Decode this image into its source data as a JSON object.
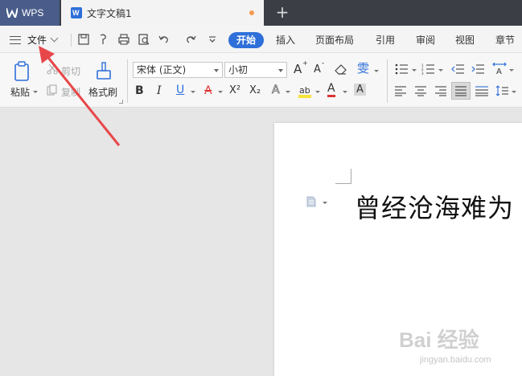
{
  "app": {
    "name": "WPS"
  },
  "tabs": {
    "doc_title": "文字文稿1",
    "add_glyph": "+"
  },
  "menu": {
    "file_label": "文件",
    "ribbon_tabs": [
      "开始",
      "插入",
      "页面布局",
      "引用",
      "审阅",
      "视图",
      "章节"
    ],
    "active_tab": "开始"
  },
  "ribbon": {
    "paste_label": "粘贴",
    "cut_label": "剪切",
    "copy_label": "复制",
    "format_painter_label": "格式刷",
    "font_name": "宋体 (正文)",
    "font_size": "小初",
    "bold": "B",
    "italic": "I",
    "underline": "U",
    "strike": "A",
    "superscript": "X²",
    "subscript": "X₂",
    "font_color": "A",
    "char_shade": "A",
    "text_effect": "A",
    "grow_font": "A",
    "shrink_font": "A",
    "phonetic": "雯"
  },
  "document": {
    "text": "曾经沧海难为"
  },
  "watermark": {
    "line1": "Bai 经验",
    "line2": "jingyan.baidu.com"
  },
  "colors": {
    "accent": "#2e6fd9",
    "arrow": "#e8474a",
    "tabbar": "#3b3f45",
    "wps_tab": "#4a5d8a"
  }
}
